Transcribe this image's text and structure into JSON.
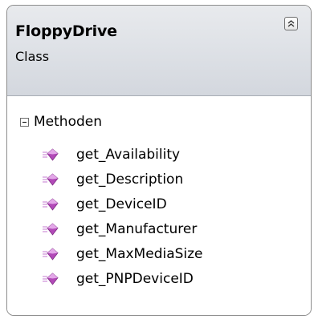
{
  "class": {
    "name": "FloppyDrive",
    "kind": "Class"
  },
  "section": {
    "title": "Methoden",
    "methods": [
      {
        "label": "get_Availability",
        "icon": "method-icon"
      },
      {
        "label": "get_Description",
        "icon": "method-icon"
      },
      {
        "label": "get_DeviceID",
        "icon": "method-icon"
      },
      {
        "label": "get_Manufacturer",
        "icon": "method-icon"
      },
      {
        "label": "get_MaxMediaSize",
        "icon": "method-icon"
      },
      {
        "label": "get_PNPDeviceID",
        "icon": "method-icon"
      }
    ]
  },
  "colors": {
    "header_bg": "#dfe2e7",
    "border": "#8c8c8c",
    "method_icon": "#b24ab8"
  }
}
